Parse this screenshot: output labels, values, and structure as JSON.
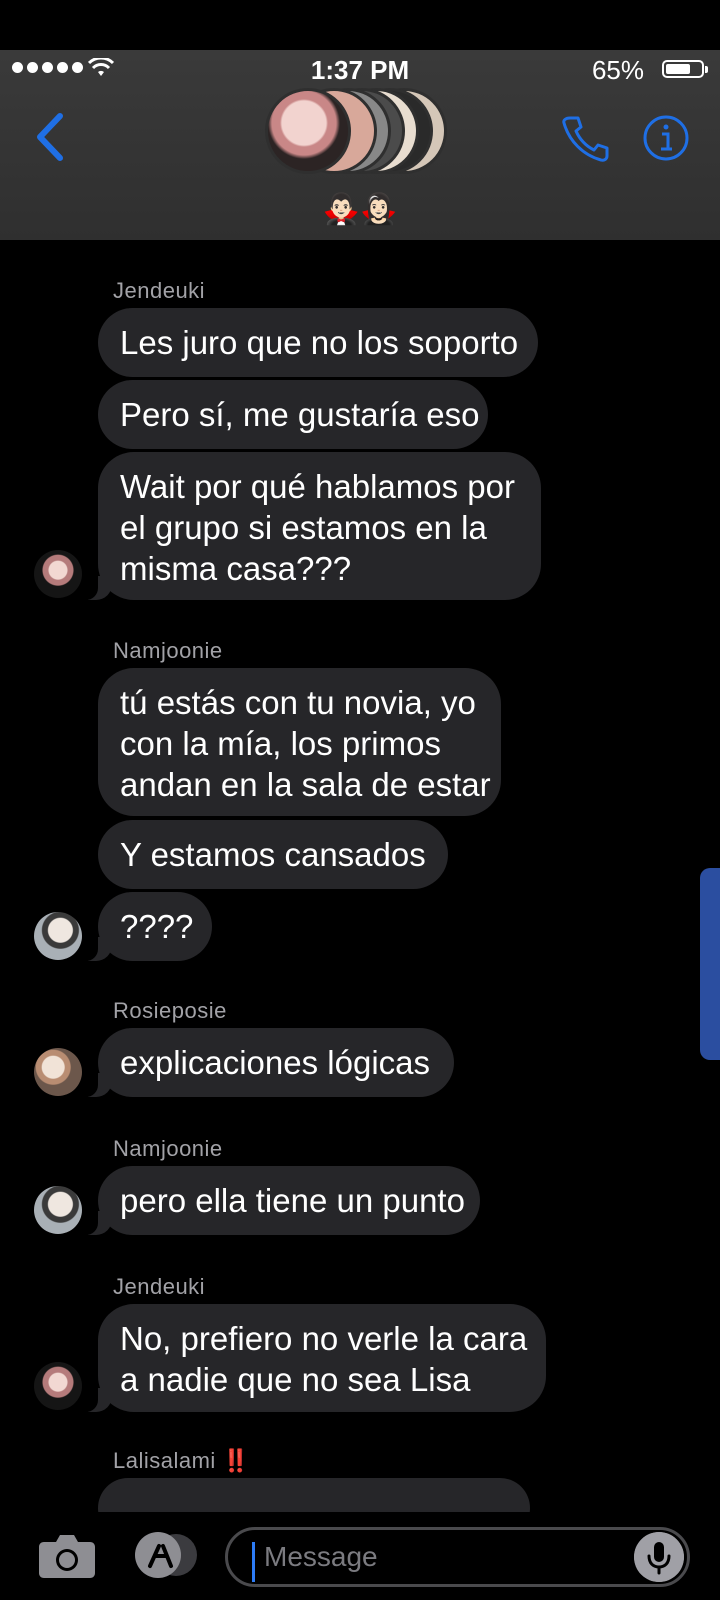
{
  "status": {
    "time": "1:37 PM",
    "battery": "65%"
  },
  "header": {
    "group_name": "🧛🏻‍♂️🧛🏻‍♀️"
  },
  "chat": {
    "sender_1": "Jendeuki",
    "msg_1": "Les juro que no los soporto",
    "msg_2": "Pero sí, me gustaría eso",
    "msg_3_line_1": "Wait por qué hablamos por",
    "msg_3_line_2": "el grupo si estamos en la",
    "msg_3_line_3": "misma casa???",
    "sender_2": "Namjoonie",
    "msg_4_line_1": "tú estás con tu novia, yo",
    "msg_4_line_2": "con la mía, los primos",
    "msg_4_line_3": "andan en la sala de estar",
    "msg_5": "Y estamos cansados",
    "msg_6": "????",
    "sender_3": "Rosieposie",
    "msg_7": "explicaciones lógicas",
    "sender_4": "Namjoonie",
    "msg_8": "pero ella tiene un punto",
    "sender_5": "Jendeuki",
    "msg_9_line_1": "No, prefiero no verle la cara",
    "msg_9_line_2": "a nadie que no sea Lisa",
    "sender_6": "Lalisalami ‼️"
  },
  "composer": {
    "placeholder": "Message"
  },
  "colors": {
    "accent": "#1f6fe5",
    "bubble": "#262629",
    "header": "#343434"
  }
}
